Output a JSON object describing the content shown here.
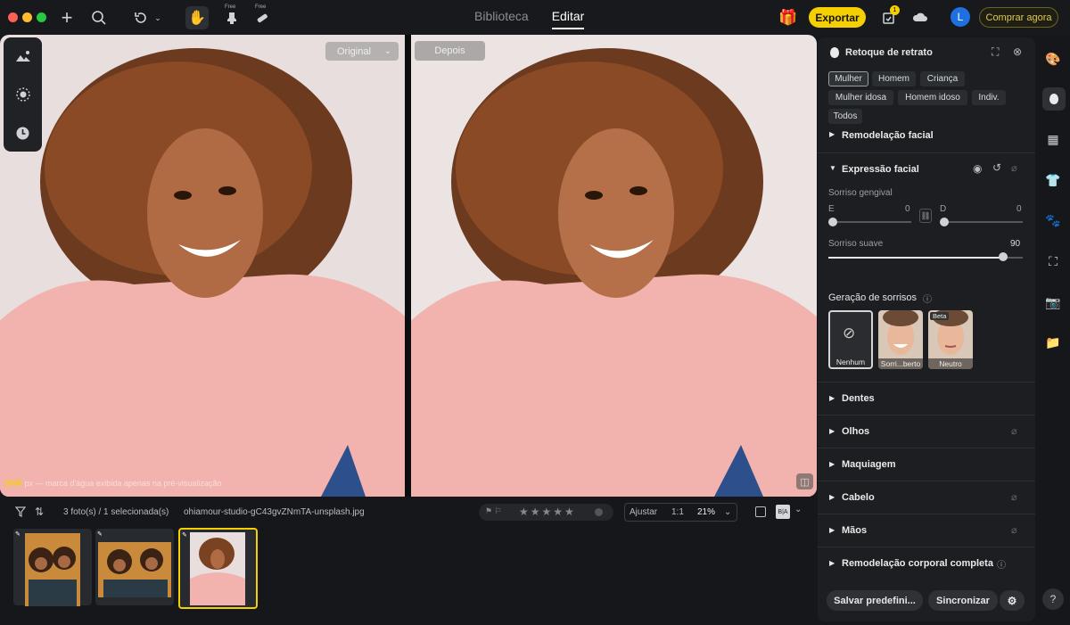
{
  "topbar": {
    "tabs": [
      {
        "label": "Biblioteca",
        "active": false
      },
      {
        "label": "Editar",
        "active": true
      }
    ],
    "free_badge": "Free",
    "notification_count": "1",
    "export_label": "Exportar",
    "avatar_initial": "L",
    "buy_label": "Comprar agora"
  },
  "viewer": {
    "original_dropdown": "Original",
    "after_label": "Depois",
    "watermark_brand": "2000",
    "watermark_text": "px — marca d'água exibida apenas na pré-visualização"
  },
  "bottombar": {
    "count_text": "3 foto(s) / 1 selecionada(s)",
    "filename": "ohiamour-studio-gC43gvZNmTA-unsplash.jpg",
    "fit_label": "Ajustar",
    "one_to_one": "1:1",
    "zoom": "21%",
    "rating": 0
  },
  "panel": {
    "title": "Retoque de retrato",
    "chips": [
      "Mulher",
      "Homem",
      "Criança",
      "Mulher idosa",
      "Homem idoso",
      "Indiv.",
      "Todos"
    ],
    "section_facial_reshape": "Remodelação facial",
    "section_expression": "Expressão facial",
    "gum_smile_label": "Sorriso gengival",
    "left_label": "E",
    "left_value": "0",
    "right_label": "D",
    "right_value": "0",
    "soft_smile_label": "Sorriso suave",
    "soft_smile_value": "90",
    "soft_smile_fraction": 0.9,
    "smile_gen_title": "Geração de sorrisos",
    "smile_options": [
      "Nenhum",
      "Sorri...berto",
      "Neutro"
    ],
    "beta_label": "Beta",
    "sections": [
      "Dentes",
      "Olhos",
      "Maquiagem",
      "Cabelo",
      "Mãos",
      "Remodelação corporal completa"
    ],
    "save_preset_label": "Salvar predefini...",
    "sync_label": "Sincronizar"
  },
  "colors": {
    "accent": "#f5d000",
    "panel_bg": "#1c1e21",
    "sweater": "#f2b3ae"
  }
}
